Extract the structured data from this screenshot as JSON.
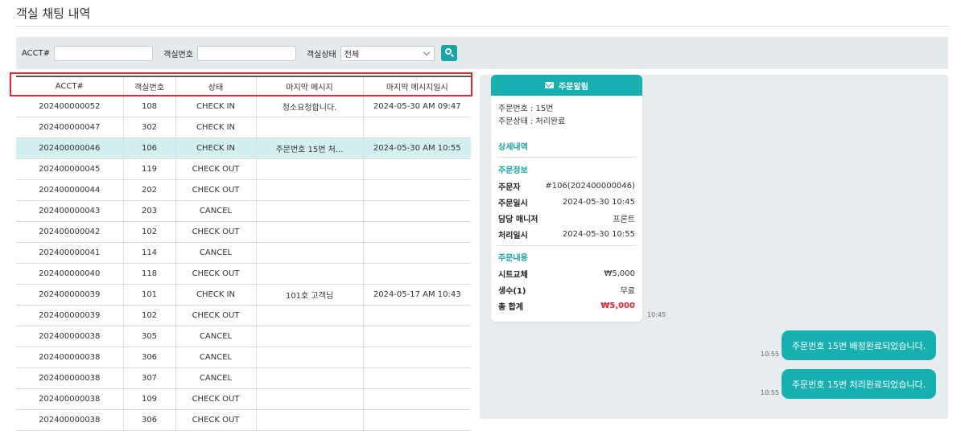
{
  "page": {
    "title": "객실 채팅 내역"
  },
  "search": {
    "acct_label": "ACCT#",
    "acct_value": "",
    "room_label": "객실번호",
    "room_value": "",
    "status_label": "객실상태",
    "status_selected": "전체"
  },
  "table": {
    "headers": [
      "ACCT#",
      "객실번호",
      "상태",
      "마지막 메시지",
      "마지막 메시지일시"
    ],
    "rows": [
      [
        "202400000052",
        "108",
        "CHECK IN",
        "청소요청합니다.",
        "2024-05-30 AM 09:47"
      ],
      [
        "202400000047",
        "302",
        "CHECK IN",
        "",
        ""
      ],
      [
        "202400000046",
        "106",
        "CHECK IN",
        "주문번호 15번 처...",
        "2024-05-30 AM 10:55"
      ],
      [
        "202400000045",
        "119",
        "CHECK OUT",
        "",
        ""
      ],
      [
        "202400000044",
        "202",
        "CHECK OUT",
        "",
        ""
      ],
      [
        "202400000043",
        "203",
        "CANCEL",
        "",
        ""
      ],
      [
        "202400000042",
        "102",
        "CHECK OUT",
        "",
        ""
      ],
      [
        "202400000041",
        "114",
        "CANCEL",
        "",
        ""
      ],
      [
        "202400000040",
        "118",
        "CHECK OUT",
        "",
        ""
      ],
      [
        "202400000039",
        "101",
        "CHECK IN",
        "101호 고객님",
        "2024-05-17 AM 10:43"
      ],
      [
        "202400000039",
        "102",
        "CHECK OUT",
        "",
        ""
      ],
      [
        "202400000038",
        "305",
        "CANCEL",
        "",
        ""
      ],
      [
        "202400000038",
        "306",
        "CANCEL",
        "",
        ""
      ],
      [
        "202400000038",
        "307",
        "CANCEL",
        "",
        ""
      ],
      [
        "202400000038",
        "109",
        "CHECK OUT",
        "",
        ""
      ],
      [
        "202400000038",
        "306",
        "CHECK OUT",
        "",
        ""
      ]
    ],
    "selected_row": 2
  },
  "chat": {
    "card": {
      "header": "주문알림",
      "order_no": "주문번호 : 15번",
      "order_status": "주문상태 : 처리완료",
      "detail_title": "상세내역",
      "order_info_title": "주문정보",
      "info": [
        {
          "k": "주문자",
          "v": "#106(202400000046)"
        },
        {
          "k": "주문일시",
          "v": "2024-05-30 10:45"
        },
        {
          "k": "담당 매니저",
          "v": "프론트"
        },
        {
          "k": "처리일시",
          "v": "2024-05-30 10:55"
        }
      ],
      "content_title": "주문내용",
      "items": [
        {
          "k": "시트교체",
          "v": "₩5,000"
        },
        {
          "k": "생수(1)",
          "v": "무료"
        }
      ],
      "total_label": "총 합계",
      "total_value": "₩5,000",
      "time": "10:45"
    },
    "messages": [
      {
        "text": "주문번호 15번 배정완료되었습니다.",
        "time": "10:55"
      },
      {
        "text": "주문번호 15번 처리완료되었습니다.",
        "time": "10:55"
      }
    ]
  },
  "colors": {
    "accent": "#17b0b0",
    "highlight_box": "#e8242c",
    "selected_row": "#d3efef",
    "total_red": "#e8242c"
  }
}
